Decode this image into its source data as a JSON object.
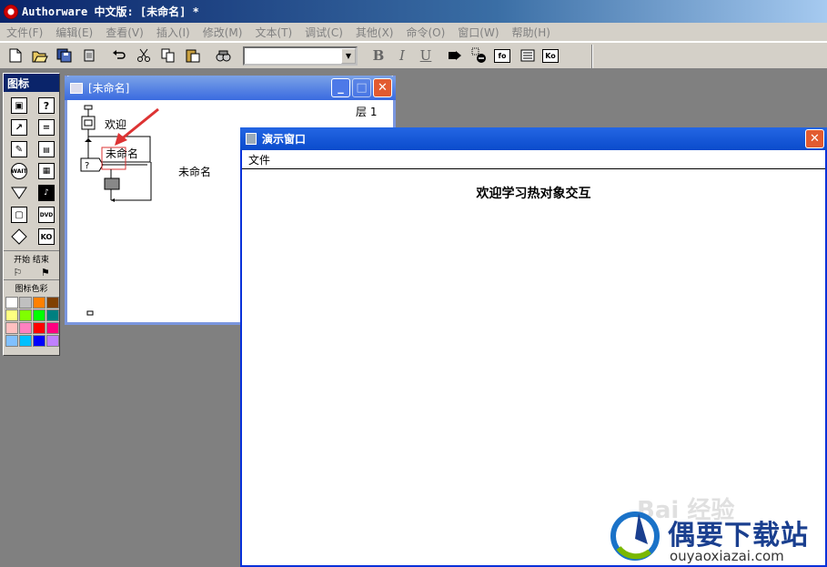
{
  "app": {
    "title": "Authorware 中文版: [未命名] *"
  },
  "menu": [
    "文件(F)",
    "编辑(E)",
    "查看(V)",
    "插入(I)",
    "修改(M)",
    "文本(T)",
    "调试(C)",
    "其他(X)",
    "命令(O)",
    "窗口(W)",
    "帮助(H)"
  ],
  "toolbar": {
    "icons": [
      "new-icon",
      "open-icon",
      "save-all-icon",
      "import-icon",
      "undo-icon",
      "cut-icon",
      "copy-icon",
      "paste-icon",
      "find-icon"
    ],
    "font_value": "",
    "bold": "B",
    "italic": "I",
    "underline": "U",
    "boxes": [
      "fo",
      "Ko"
    ]
  },
  "palette": {
    "title": "图标",
    "icons": [
      "display",
      "interaction",
      "motion",
      "calculation",
      "erase",
      "map",
      "wait",
      "digital-movie",
      "navigate",
      "sound",
      "framework",
      "dvd",
      "decision",
      "knowledge-object"
    ],
    "wait_text": "WAIT",
    "dvd_text": "DVD",
    "ko_text": "KO",
    "start_end_label": "开始 结束",
    "color_label": "图标色彩",
    "colors": [
      "#ffffff",
      "#c0c0c0",
      "#ff8000",
      "#804000",
      "#ffff80",
      "#80ff00",
      "#00ff00",
      "#008080",
      "#ffc0c0",
      "#ff80c0",
      "#ff0000",
      "#ff0080",
      "#80c0ff",
      "#00c0ff",
      "#0000ff",
      "#c080ff"
    ]
  },
  "flow_window": {
    "title": "[未命名]",
    "layer": "层 1",
    "icon1_label": "欢迎",
    "branch_label": "未命名",
    "right_label": "未命名"
  },
  "presentation": {
    "title": "演示窗口",
    "menu_file": "文件",
    "heading": "欢迎学习热对象交互"
  },
  "watermark": {
    "baidu": "Bai 经验",
    "name": "偶要下载站",
    "url": "ouyaoxiazai.com"
  }
}
